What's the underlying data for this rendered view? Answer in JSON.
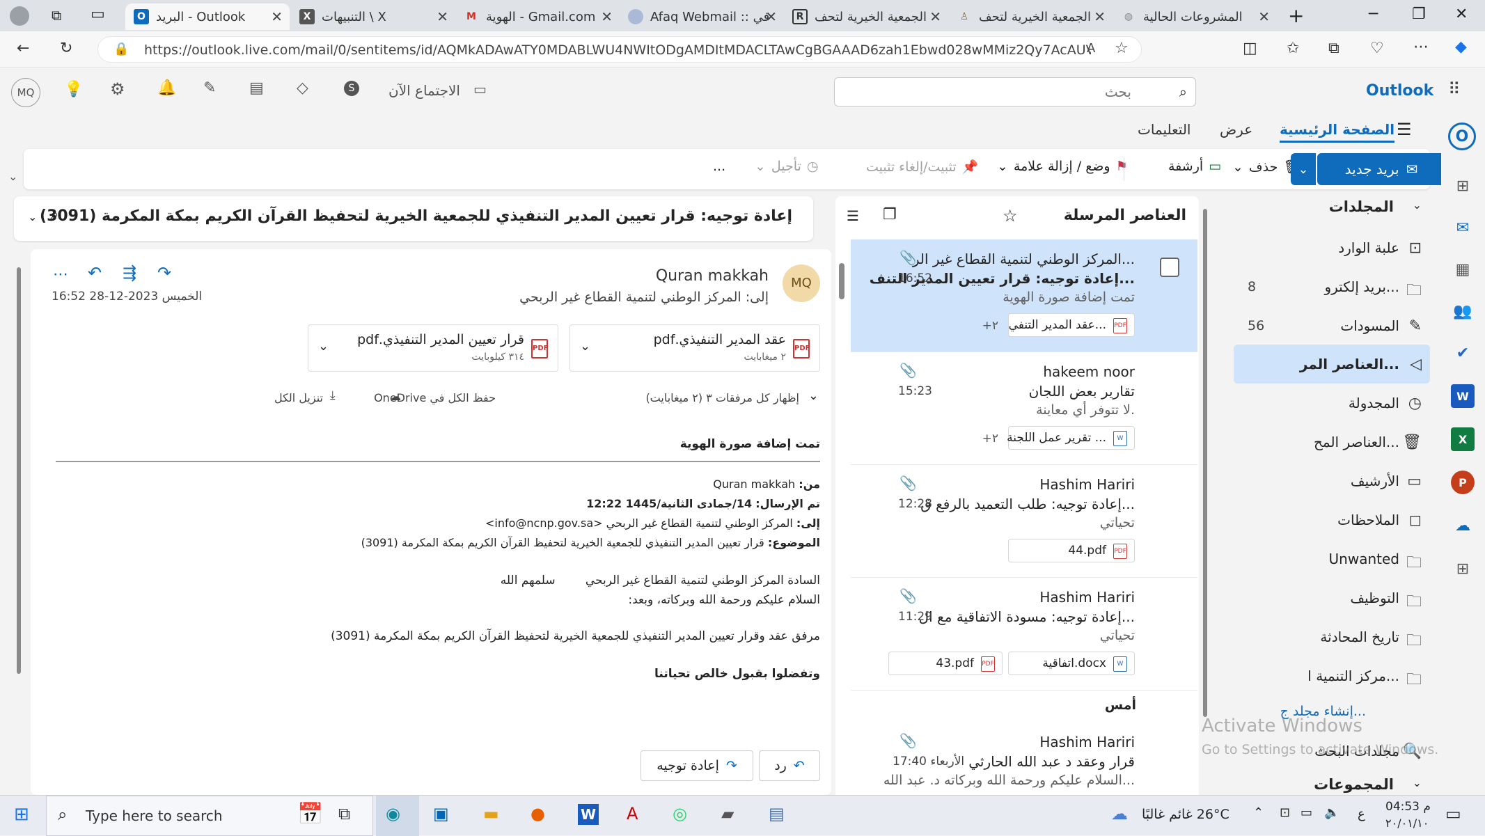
{
  "browser": {
    "tabs": [
      {
        "label": "البريد - Outlook",
        "active": false
      },
      {
        "label": "التنبيهات \\ X",
        "active": false
      },
      {
        "label": "الهوية - Gmail.com",
        "active": false
      },
      {
        "label": "Afaq Webmail :: في",
        "active": false
      },
      {
        "label": "الجمعية الخيرية لتحف",
        "active": false
      },
      {
        "label": "الجمعية الخيرية لتحف",
        "active": false
      },
      {
        "label": "المشروعات الحالية",
        "active": false
      }
    ],
    "url": "https://outlook.live.com/mail/0/sentitems/id/AQMkADAwATY0MDABLWU4NWItODgAMDItMDACLTAwCgBGAAAD6zah1Ebwd028wMMiz2Qy7AcAUVUnwc75GkS64q..."
  },
  "header": {
    "brand": "Outlook",
    "search_placeholder": "بحث",
    "meet_now": "الاجتماع الآن",
    "avatar": "MQ"
  },
  "ribbon_tabs": [
    "الصفحة الرئيسية",
    "عرض",
    "التعليمات"
  ],
  "ribbon": {
    "new_mail": "بريد جديد",
    "delete": "حذف",
    "archive": "أرشفة",
    "flag": "وضع / إزالة علامة",
    "pin": "تثبيت/إلغاء تثبيت",
    "snooze": "تأجيل",
    "more": "..."
  },
  "folders": {
    "heading": "المجلدات",
    "items": [
      {
        "label": "علبة الوارد",
        "count": "",
        "icon": "inbox-icon"
      },
      {
        "label": "بريد إلكترو...",
        "count": "8",
        "icon": "junk-icon"
      },
      {
        "label": "المسودات",
        "count": "56",
        "icon": "pencil-icon"
      },
      {
        "label": "العناصر المر...",
        "count": "",
        "icon": "send-icon",
        "selected": true
      },
      {
        "label": "المجدولة",
        "count": "",
        "icon": "clock-icon"
      },
      {
        "label": "العناصر المح...",
        "count": "",
        "icon": "trash-icon"
      },
      {
        "label": "الأرشيف",
        "count": "",
        "icon": "archive-icon"
      },
      {
        "label": "الملاحظات",
        "count": "",
        "icon": "note-icon"
      },
      {
        "label": "Unwanted",
        "count": "",
        "icon": "folder-icon"
      },
      {
        "label": "التوظيف",
        "count": "",
        "icon": "folder-icon"
      },
      {
        "label": "تاريخ المحادثة",
        "count": "",
        "icon": "folder-icon"
      },
      {
        "label": "مركز التنمية ا...",
        "count": "",
        "icon": "folder-icon"
      }
    ],
    "create_folder": "إنشاء مجلد ج...",
    "search_folders": "مجلدات البحث",
    "groups": "المجموعات"
  },
  "message_list": {
    "title": "العناصر المرسلة",
    "yesterday": "أمس",
    "messages": [
      {
        "sender": "المركز الوطني لتنمية القطاع غير الر...",
        "subject": "إعادة توجيه: قرار تعيين المدير التنف...",
        "preview": "تمت إضافة صورة الهوية",
        "time": "16:52",
        "attachment": "عقد المدير التنفي...",
        "more": "+٢",
        "doc": false
      },
      {
        "sender": "hakeem noor",
        "subject": "تقارير بعض اللجان",
        "preview": "لا تتوفر أي معاينة.",
        "time": "15:23",
        "attachment": "تقرير عمل اللجنة ...",
        "more": "+٢",
        "doc": true
      },
      {
        "sender": "Hashim Hariri",
        "subject": "إعادة توجيه: طلب التعميد بالرفع ق...",
        "preview": "تحياتي",
        "time": "12:28",
        "attachment": "44.pdf",
        "more": "",
        "doc": false
      },
      {
        "sender": "Hashim Hariri",
        "subject": "إعادة توجيه: مسودة الاتفاقية مع ال...",
        "preview": "تحياتي",
        "time": "11:29",
        "attachment": "اتفاقية.docx",
        "attachment2": "43.pdf",
        "more": "",
        "doc": true
      },
      {
        "sender": "Hashim Hariri",
        "subject": "قرار وعقد د عبد الله الحارثي",
        "preview": "السلام عليكم ورحمة الله وبركاته د. عبد الله...",
        "time": "17:40 الأربعاء",
        "attachment": "",
        "more": "",
        "doc": false
      }
    ]
  },
  "reading": {
    "subject": "إعادة توجيه: قرار تعيين المدير التنفيذي للجمعية الخيرية لتحفيظ القرآن الكريم بمكة المكرمة (3091)",
    "sender": "Quran makkah",
    "avatar": "MQ",
    "to": "إلى: المركز الوطني لتنمية القطاع غير الربحي",
    "date": "الخميس 2023-12-28 16:52",
    "attachments": [
      {
        "name": "عقد المدير التنفيذي.pdf",
        "size": "٢ ميغابايت"
      },
      {
        "name": "قرار تعيين المدير التنفيذي.pdf",
        "size": "٣١٤ كيلوبايت"
      }
    ],
    "show_all": "إظهار كل مرفقات ٣ (٢ ميغابايت)",
    "save_all": "حفظ الكل في OneDrive",
    "download_all": "تنزيل الكل",
    "body_top": "تمت إضافة صورة الهوية",
    "from_label": "من:",
    "from_value": "Quran makkah",
    "sent_label": "تم الإرسال:",
    "sent_value": "14/جمادى الثانية/1445 12:22",
    "to_label": "إلى:",
    "to_value": "المركز الوطني لتنمية القطاع غير الربحي <info@ncnp.gov.sa>",
    "subject_label": "الموضوع:",
    "subject_value": "قرار تعيين المدير التنفيذي للجمعية الخيرية لتحفيظ القرآن الكريم بمكة المكرمة (3091)",
    "greeting1": "السادة المركز الوطني لتنمية القطاع غير الربحي        سلمهم الله",
    "greeting2": "السلام عليكم ورحمة الله وبركاته، وبعد:",
    "para": "مرفق عقد وقرار تعيين المدير التنفيذي للجمعية الخيرية لتحفيظ القرآن الكريم بمكة المكرمة (3091)",
    "closing": "وتفضلوا بقبول خالص تحياتنا",
    "reply": "رد",
    "forward": "إعادة توجيه"
  },
  "watermark": {
    "line1": "Activate Windows",
    "line2": "Go to Settings to activate Windows."
  },
  "taskbar": {
    "search_placeholder": "Type here to search",
    "weather": "26°C  غائم غالبًا",
    "time": "04:53 م",
    "date": "٢٠/٠١/١٠",
    "lang": "ع"
  },
  "colors": {
    "accent": "#0f6cbd",
    "selected": "#cfe4fa"
  }
}
